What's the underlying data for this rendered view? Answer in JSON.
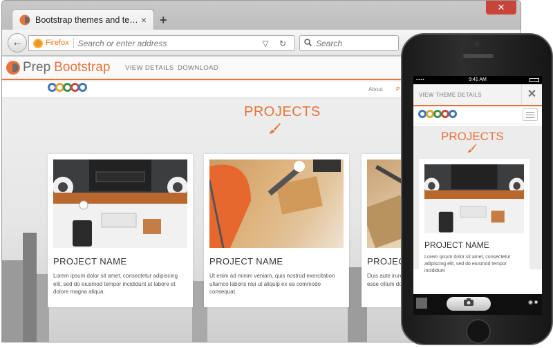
{
  "browser": {
    "tab_title": "Bootstrap themes and te…",
    "tab_close": "×",
    "new_tab": "+",
    "window_close": "✕",
    "back": "←",
    "identity_label": "Firefox",
    "url_placeholder": "Search or enter address",
    "url_icons": "▽ ↻",
    "search_placeholder": "Search",
    "search_icon": "🔍"
  },
  "prepbootstrap": {
    "logo_prep": "Prep",
    "logo_bootstrap": "Bootstrap",
    "nav": [
      "VIEW DETAILS",
      "DOWNLOAD"
    ]
  },
  "site": {
    "nav": [
      "About",
      "P"
    ],
    "ring_colors": [
      "#3f76b5",
      "#e4a431",
      "#3f8f4f",
      "#c24c3c",
      "#3f76b5"
    ],
    "section_title": "PROJECTS",
    "accent": "#e8743b",
    "cards": [
      {
        "title": "PROJECT NAME",
        "text": "Lorem ipsum dolor sit amet, consectetur adipiscing elit, sed do eiusmod tempor incididunt ut labore et dolore magna aliqua."
      },
      {
        "title": "PROJECT NAME",
        "text": "Ut enim ad minim veniam, quis nostrud exercitation ullamco laboris nisi ut aliquip ex ea commodo consequat."
      },
      {
        "title": "PROJECT NAME",
        "text": "Duis aute irure dolor in reprehenderit in voluptate velit esse cillum dolore eu fugiat nulla pariatur."
      }
    ]
  },
  "phone": {
    "time": "9:41 AM",
    "top_label": "VIEW THEME DETAILS",
    "close": "✕",
    "section_title": "PROJECTS",
    "card_title": "PROJECT NAME",
    "card_text": "Lorem ipsum dolor sit amet, consectetur adipiscing elit, sed do eiusmod tempor incididunt"
  }
}
